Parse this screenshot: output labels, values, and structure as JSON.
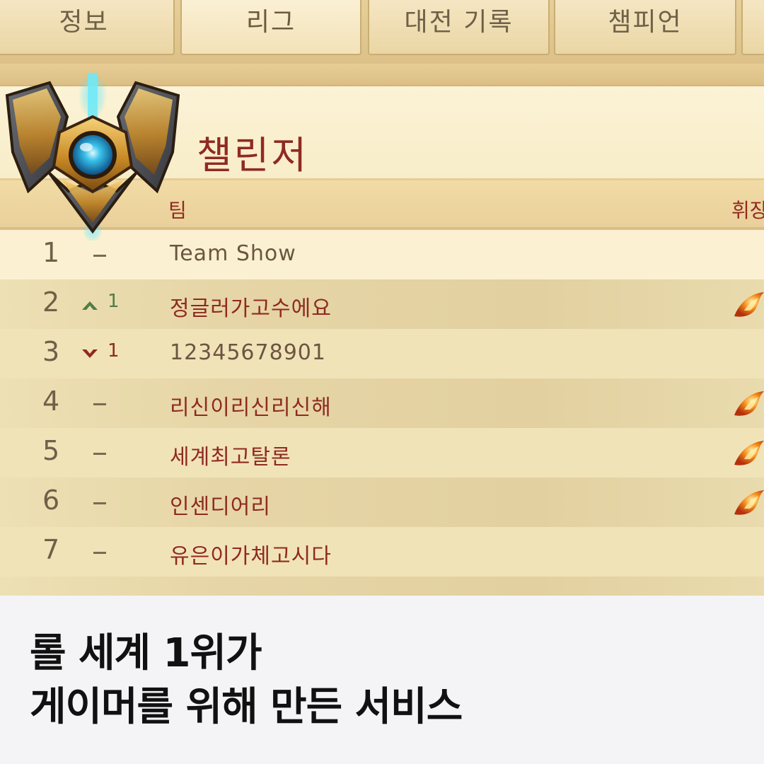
{
  "tabs": [
    {
      "label": "정보"
    },
    {
      "label": "리그"
    },
    {
      "label": "대전 기록"
    },
    {
      "label": "챔피언"
    }
  ],
  "tier": {
    "name": "챌린저",
    "emblem_icon": "challenger-emblem-icon"
  },
  "table": {
    "headers": {
      "team": "팀",
      "emblem": "휘장"
    },
    "rows": [
      {
        "rank": "1",
        "change": "",
        "direction": "none",
        "team": "Team Show",
        "badge": false
      },
      {
        "rank": "2",
        "change": "1",
        "direction": "up",
        "team": "정글러가고수에요",
        "badge": true
      },
      {
        "rank": "3",
        "change": "1",
        "direction": "down",
        "team": "12345678901",
        "badge": false
      },
      {
        "rank": "4",
        "change": "",
        "direction": "none",
        "team": "리신이리신리신해",
        "badge": true
      },
      {
        "rank": "5",
        "change": "",
        "direction": "none",
        "team": "세계최고탈론",
        "badge": true
      },
      {
        "rank": "6",
        "change": "",
        "direction": "none",
        "team": "인센디어리",
        "badge": true
      },
      {
        "rank": "7",
        "change": "",
        "direction": "none",
        "team": "유은이가체고시다",
        "badge": false
      }
    ]
  },
  "caption": {
    "line1": "롤 세계 1위가",
    "line2": "게이머를 위해 만든 서비스"
  },
  "colors": {
    "accent_red": "#8f2a22",
    "up_green": "#4f7e48",
    "caption_bg": "#f4f4f6"
  }
}
